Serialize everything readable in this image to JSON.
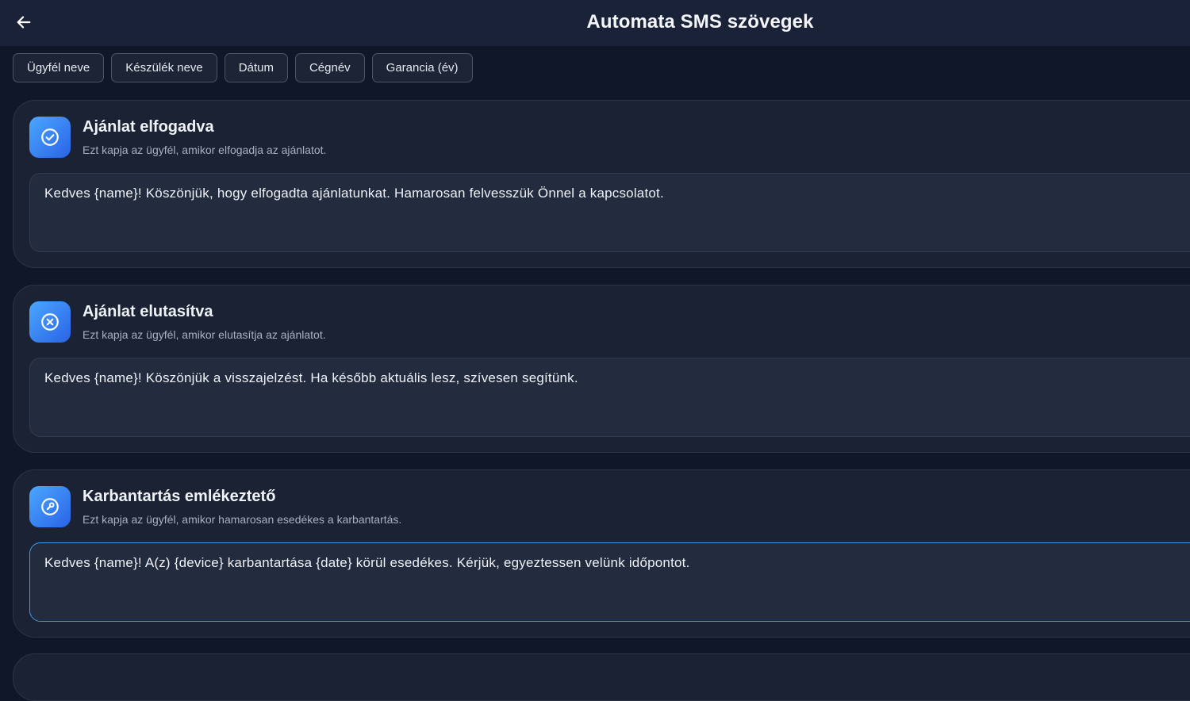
{
  "header": {
    "title": "Automata SMS szövegek",
    "back_icon": "arrow-left-icon"
  },
  "placeholders": [
    {
      "label": "Ügyfél neve"
    },
    {
      "label": "Készülék neve"
    },
    {
      "label": "Dátum"
    },
    {
      "label": "Cégnév"
    },
    {
      "label": "Garancia (év)"
    }
  ],
  "templates": [
    {
      "icon": "check-circle-icon",
      "title": "Ajánlat elfogadva",
      "subtitle": "Ezt kapja az ügyfél, amikor elfogadja az ajánlatot.",
      "text": "Kedves {name}! Köszönjük, hogy elfogadta ajánlatunkat. Hamarosan felvesszük Önnel a kapcsolatot."
    },
    {
      "icon": "x-circle-icon",
      "title": "Ajánlat elutasítva",
      "subtitle": "Ezt kapja az ügyfél, amikor elutasítja az ajánlatot.",
      "text": "Kedves {name}! Köszönjük a visszajelzést. Ha később aktuális lesz, szívesen segítünk."
    },
    {
      "icon": "wrench-icon",
      "title": "Karbantartás emlékeztető",
      "subtitle": "Ezt kapja az ügyfél, amikor hamarosan esedékes a karbantartás.",
      "text": "Kedves {name}! A(z) {device} karbantartása {date} körül esedékes. Kérjük, egyeztessen velünk időpontot."
    }
  ],
  "colors": {
    "background": "#0f1729",
    "app_bar": "#1a2238",
    "card": "#1b2233",
    "accent": "#3b9be8",
    "icon_gradient_start": "#4aa8ff",
    "icon_gradient_end": "#2a62e6"
  }
}
